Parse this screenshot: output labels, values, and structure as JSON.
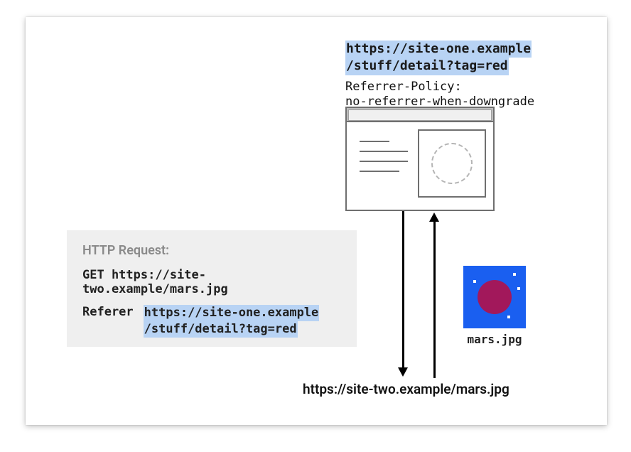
{
  "origin_url_line1": "https://site-one.example",
  "origin_url_line2": "/stuff/detail?tag=red",
  "referrer_policy_label": "Referrer-Policy:",
  "referrer_policy_value": "no-referrer-when-downgrade",
  "http_request": {
    "title": "HTTP Request:",
    "method_line": "GET https://site-two.example/mars.jpg",
    "referer_label": "Referer",
    "referer_value_line1": "https://site-one.example",
    "referer_value_line2": "/stuff/detail?tag=red"
  },
  "resource": {
    "filename": "mars.jpg",
    "url": "https://site-two.example/mars.jpg"
  }
}
